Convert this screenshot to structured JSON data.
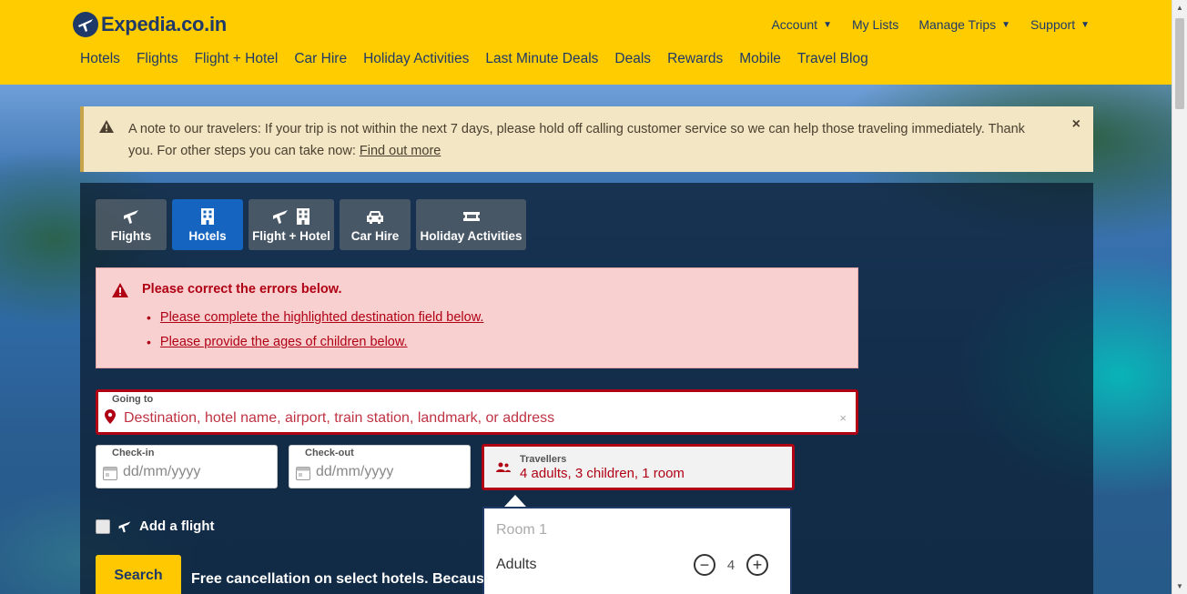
{
  "header": {
    "brand": "Expedia.co.in",
    "top_links": [
      {
        "label": "Account",
        "has_caret": true
      },
      {
        "label": "My Lists",
        "has_caret": false
      },
      {
        "label": "Manage Trips",
        "has_caret": true
      },
      {
        "label": "Support",
        "has_caret": true
      }
    ],
    "nav": [
      "Hotels",
      "Flights",
      "Flight + Hotel",
      "Car Hire",
      "Holiday Activities",
      "Last Minute Deals",
      "Deals",
      "Rewards",
      "Mobile",
      "Travel Blog"
    ]
  },
  "notice": {
    "text": "A note to our travelers: If your trip is not within the next 7 days, please hold off calling customer service so we can help those traveling immediately. Thank you. For other steps you can take now: ",
    "link": "Find out more",
    "close": "×"
  },
  "tabs": [
    {
      "label": "Flights",
      "icons": [
        "plane-icon"
      ],
      "active": false
    },
    {
      "label": "Hotels",
      "icons": [
        "building-icon"
      ],
      "active": true
    },
    {
      "label": "Flight + Hotel",
      "icons": [
        "plane-icon",
        "building-icon"
      ],
      "active": false
    },
    {
      "label": "Car Hire",
      "icons": [
        "car-icon"
      ],
      "active": false
    },
    {
      "label": "Holiday Activities",
      "icons": [
        "ticket-icon"
      ],
      "active": false
    }
  ],
  "errors": {
    "title": "Please correct the errors below.",
    "items": [
      "Please complete the highlighted destination field below.",
      "Please provide the ages of children below."
    ]
  },
  "form": {
    "going_to_label": "Going to",
    "going_to_placeholder": "Destination, hotel name, airport, train station, landmark, or address",
    "clear": "×",
    "checkin_label": "Check-in",
    "checkin_placeholder": "dd/mm/yyyy",
    "checkout_label": "Check-out",
    "checkout_placeholder": "dd/mm/yyyy",
    "travellers_label": "Travellers",
    "travellers_value": "4 adults, 3 children, 1 room",
    "add_flight": "Add a flight",
    "search": "Search",
    "free_cancel": "Free cancellation on select hotels. Because"
  },
  "popover": {
    "room_title": "Room 1",
    "adults_label": "Adults",
    "adults_value": "4",
    "minus": "−",
    "plus": "+"
  },
  "colors": {
    "header_bg": "#ffcc00",
    "brand_navy": "#1f3a68",
    "active_tab": "#1565c0",
    "error_red": "#b00014",
    "error_bg": "#f9d0d0",
    "notice_bg": "#f3e6c4",
    "search_button": "#ffc800"
  }
}
